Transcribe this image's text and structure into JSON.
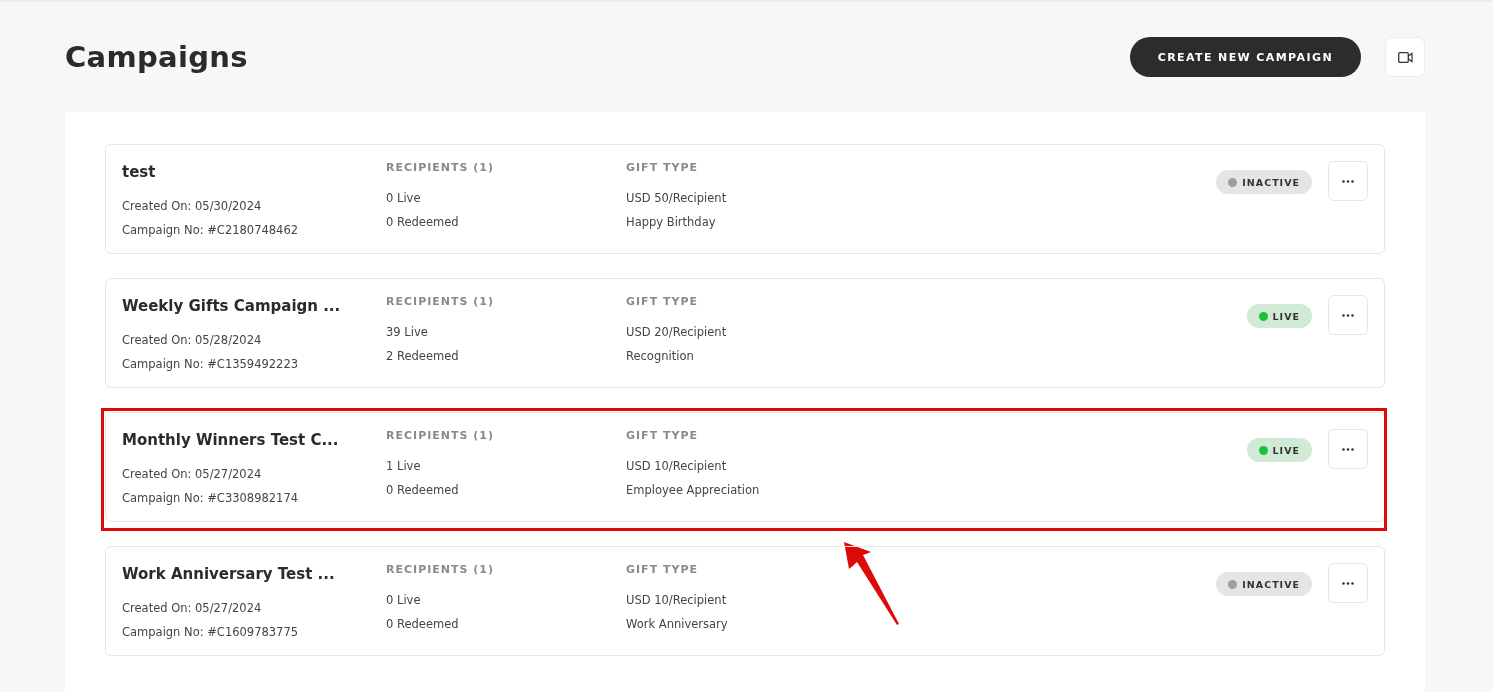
{
  "page": {
    "title": "Campaigns",
    "create_button": "CREATE NEW CAMPAIGN"
  },
  "campaigns": [
    {
      "name": "test",
      "created": "Created On: 05/30/2024",
      "number": "Campaign No: #C2180748462",
      "recipients_header": "RECIPIENTS (1)",
      "live": "0 Live",
      "redeemed": "0 Redeemed",
      "gift_header": "GIFT TYPE",
      "amount": "USD 50/Recipient",
      "gift": "Happy Birthday",
      "status": "INACTIVE",
      "color": "#9e9e9e",
      "highlighted": false
    },
    {
      "name": "Weekly Gifts Campaign ...",
      "created": "Created On: 05/28/2024",
      "number": "Campaign No: #C1359492223",
      "recipients_header": "RECIPIENTS (1)",
      "live": "39 Live",
      "redeemed": "2 Redeemed",
      "gift_header": "GIFT TYPE",
      "amount": "USD 20/Recipient",
      "gift": "Recognition",
      "status": "LIVE",
      "color": "#1fbf3a",
      "highlighted": false
    },
    {
      "name": "Monthly Winners Test C...",
      "created": "Created On: 05/27/2024",
      "number": "Campaign No: #C3308982174",
      "recipients_header": "RECIPIENTS (1)",
      "live": "1 Live",
      "redeemed": "0 Redeemed",
      "gift_header": "GIFT TYPE",
      "amount": "USD 10/Recipient",
      "gift": "Employee Appreciation",
      "status": "LIVE",
      "color": "#1fbf3a",
      "highlighted": true
    },
    {
      "name": "Work Anniversary Test ...",
      "created": "Created On: 05/27/2024",
      "number": "Campaign No: #C1609783775",
      "recipients_header": "RECIPIENTS (1)",
      "live": "0 Live",
      "redeemed": "0 Redeemed",
      "gift_header": "GIFT TYPE",
      "amount": "USD 10/Recipient",
      "gift": "Work Anniversary",
      "status": "INACTIVE",
      "color": "#9e9e9e",
      "highlighted": false
    }
  ]
}
